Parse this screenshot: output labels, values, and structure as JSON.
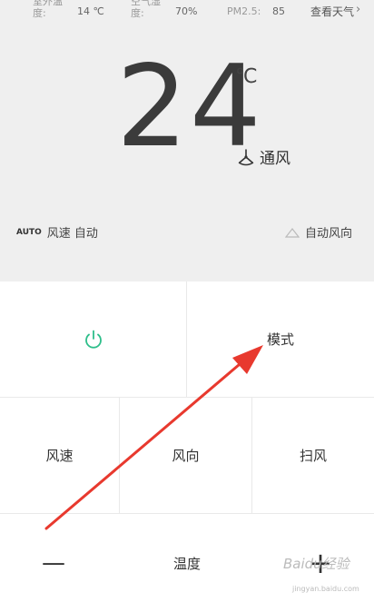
{
  "info_bar": {
    "outdoor_temp_label_line1": "室外温",
    "outdoor_temp_label_line2": "度:",
    "outdoor_temp_value": "14 ℃",
    "humidity_label_line1": "空气湿",
    "humidity_label_line2": "度:",
    "humidity_value": "70%",
    "pm_label": "PM2.5:",
    "pm_value": "85",
    "weather_link": "查看天气",
    "chevron": "›"
  },
  "display": {
    "temperature": "24",
    "unit": "℃",
    "mode": "通风",
    "fan_auto_tag": "AUTO",
    "fan_speed_label": "风速 自动",
    "wind_direction_label": "自动风向"
  },
  "buttons": {
    "mode": "模式",
    "fan_speed": "风速",
    "wind_direction": "风向",
    "swing": "扫风",
    "minus": "—",
    "temperature": "温度",
    "plus": "+"
  },
  "watermark": {
    "logo": "Baidu经验",
    "site": "jingyan.baidu.com"
  },
  "colors": {
    "power_icon": "#2dbe8a",
    "arrow": "#e8392e",
    "panel_bg": "#efefef"
  }
}
